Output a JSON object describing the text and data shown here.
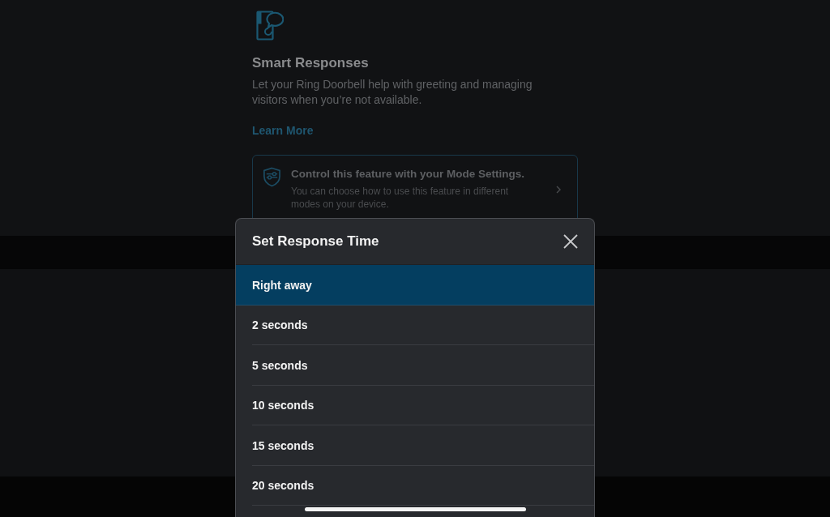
{
  "feature": {
    "title": "Smart Responses",
    "description": "Let your Ring Doorbell help with greeting and managing visitors when you’re not available.",
    "link": "Learn More"
  },
  "mode_card": {
    "title": "Control this feature with your Mode Settings.",
    "description": "You can choose how to use this feature in different modes on your device."
  },
  "dialog": {
    "title": "Set Response Time",
    "options": [
      {
        "label": "Right away",
        "selected": true
      },
      {
        "label": "2 seconds",
        "selected": false
      },
      {
        "label": "5 seconds",
        "selected": false
      },
      {
        "label": "10 seconds",
        "selected": false
      },
      {
        "label": "15 seconds",
        "selected": false
      },
      {
        "label": "20 seconds",
        "selected": false
      }
    ]
  }
}
